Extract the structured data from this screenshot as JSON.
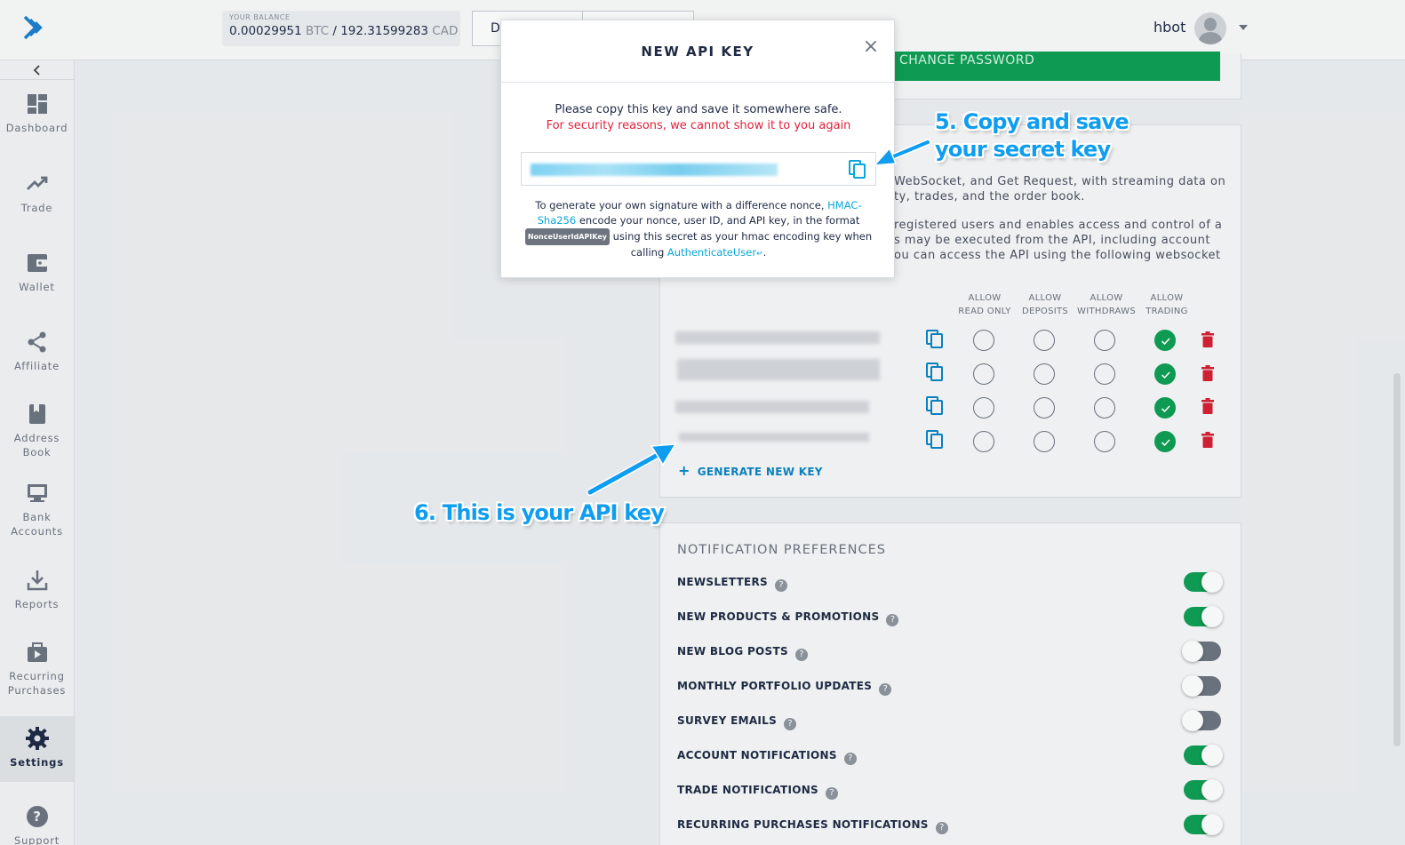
{
  "header": {
    "balance_label": "YOUR BALANCE",
    "balance_btc": "0.00029951",
    "balance_btc_unit": "BTC",
    "balance_sep": "/",
    "balance_cad": "192.31599283",
    "balance_cad_unit": "CAD",
    "partial_button": "D",
    "username": "hbot"
  },
  "sidebar": {
    "collapse_icon": "chevron-left",
    "items": [
      {
        "label": "Dashboard",
        "icon": "dashboard-icon"
      },
      {
        "label": "Trade",
        "icon": "trending-up-icon"
      },
      {
        "label": "Wallet",
        "icon": "wallet-icon"
      },
      {
        "label": "Affiliate",
        "icon": "share-icon"
      },
      {
        "label": "Address Book",
        "icon": "book-icon"
      },
      {
        "label": "Bank Accounts",
        "icon": "bank-icon"
      },
      {
        "label": "Reports",
        "icon": "download-icon"
      },
      {
        "label": "Recurring Purchases",
        "icon": "recurring-icon"
      },
      {
        "label": "Settings",
        "icon": "gear-icon",
        "active": true
      },
      {
        "label": "Support",
        "icon": "help-icon"
      }
    ]
  },
  "security": {
    "change_password_label": "CHANGE PASSWORD"
  },
  "api": {
    "desc_line1": "WebSocket, and Get Request, with streaming data on",
    "desc_line2": "ty, trades, and the order book.",
    "desc_line3": "registered users and enables access and control of a",
    "desc_line4": "s may be executed from the API, including account",
    "desc_line5": "ou can access the API using the following websocket",
    "columns": [
      {
        "l1": "ALLOW",
        "l2": "READ ONLY"
      },
      {
        "l1": "ALLOW",
        "l2": "DEPOSITS"
      },
      {
        "l1": "ALLOW",
        "l2": "WITHDRAWS"
      },
      {
        "l1": "ALLOW",
        "l2": "TRADING"
      }
    ],
    "keys": [
      {
        "read_only": false,
        "deposits": false,
        "withdraws": false,
        "trading": true
      },
      {
        "read_only": false,
        "deposits": false,
        "withdraws": false,
        "trading": true
      },
      {
        "read_only": false,
        "deposits": false,
        "withdraws": false,
        "trading": true
      },
      {
        "read_only": false,
        "deposits": false,
        "withdraws": false,
        "trading": true
      }
    ],
    "generate_label": "GENERATE NEW KEY"
  },
  "notifications": {
    "title": "NOTIFICATION PREFERENCES",
    "items": [
      {
        "label": "NEWSLETTERS",
        "on": true
      },
      {
        "label": "NEW PRODUCTS & PROMOTIONS",
        "on": true
      },
      {
        "label": "NEW BLOG POSTS",
        "on": false
      },
      {
        "label": "MONTHLY PORTFOLIO UPDATES",
        "on": false
      },
      {
        "label": "SURVEY EMAILS",
        "on": false
      },
      {
        "label": "ACCOUNT NOTIFICATIONS",
        "on": true
      },
      {
        "label": "TRADE NOTIFICATIONS",
        "on": true
      },
      {
        "label": "RECURRING PURCHASES NOTIFICATIONS",
        "on": true
      }
    ]
  },
  "modal": {
    "title": "NEW API KEY",
    "line1": "Please copy this key and save it somewhere safe.",
    "line2": "For security reasons, we cannot show it to you again",
    "para_a": "To generate your own signature with a difference nonce,",
    "para_link1": "HMAC-Sha256",
    "para_b": "encode your nonce, user ID, and API key, in the format",
    "para_badge": "NonceUserIdAPIKey",
    "para_c": "using this secret as your hmac encoding key when calling",
    "para_link2": "AuthenticateUser",
    "para_end": "."
  },
  "annotations": {
    "step5_line1": "5. Copy and save",
    "step5_line2": "your secret key",
    "step6": "6. This is your API key"
  },
  "colors": {
    "accent": "#0e9f55",
    "danger": "#d61f33",
    "link": "#0aa7d9",
    "annotation": "#0f9df0"
  }
}
